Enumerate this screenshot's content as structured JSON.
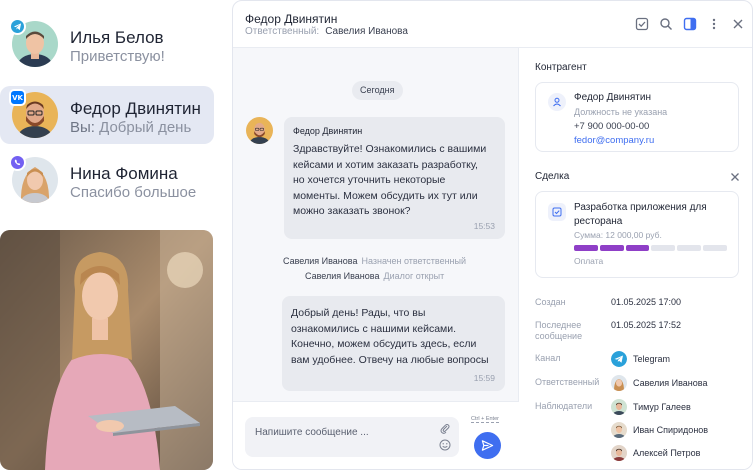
{
  "contacts": [
    {
      "name": "Илья Белов",
      "preview": "Приветствую!",
      "channel": "telegram-icon"
    },
    {
      "name": "Федор Двинятин",
      "preview_prefix": "Вы:",
      "preview": "Добрый день",
      "channel": "vk-icon",
      "channel_text": "VK"
    },
    {
      "name": "Нина Фомина",
      "preview": "Спасибо большое",
      "channel": "viber-icon"
    }
  ],
  "header": {
    "name": "Федор Двинятин",
    "responsible_label": "Ответственный:",
    "responsible_value": "Савелия Иванова"
  },
  "chat": {
    "date": "Сегодня",
    "incoming": {
      "author": "Федор Двинятин",
      "text": "Здравствуйте! Ознакомились с вашими\nкейсами и хотим заказать разработку,\nно хочется уточнить некоторые\nмоменты. Можем обсудить их тут или\nможно заказать звонок?",
      "time": "15:53"
    },
    "system": [
      {
        "actor": "Савелия Иванова",
        "event": "Назначен ответственный"
      },
      {
        "actor": "Савелия Иванова",
        "event": "Диалог открыт"
      }
    ],
    "outgoing": {
      "text": "Добрый день! Рады, что вы\nознакомились с нашими кейсами.\nКонечно, можем обсудить здесь, если\nвам удобнее. Отвечу на любые вопросы",
      "time": "15:59"
    }
  },
  "composer": {
    "placeholder": "Напишите сообщение ...",
    "hint": "Ctrl + Enter"
  },
  "info": {
    "contractor_title": "Контрагент",
    "contact": {
      "name": "Федор Двинятин",
      "position": "Должность не указана",
      "phone": "+7 900 000-00-00",
      "email": "fedor@company.ru"
    },
    "deal_title": "Сделка",
    "deal": {
      "name": "Разработка приложения для ресторана",
      "sum": "Сумма: 12 000,00 руб.",
      "stage": "Оплата",
      "stages_total": 6,
      "stages_done": 3
    },
    "meta": {
      "created_label": "Создан",
      "created_value": "01.05.2025 17:00",
      "last_msg_label": "Последнее сообщение",
      "last_msg_value": "01.05.2025 17:52",
      "channel_label": "Канал",
      "channel_value": "Telegram",
      "responsible_label": "Ответственный",
      "responsible_value": "Савелия Иванова",
      "observers_label": "Наблюдатели",
      "observers": [
        "Тимур Галеев",
        "Иван Спиридонов",
        "Алексей Петров"
      ]
    }
  },
  "colors": {
    "accent": "#3f6ef0",
    "selected_row": "#e4e8f3",
    "deal_progress": "#8f3fc7",
    "telegram": "#2aa1da",
    "vk": "#0077ff",
    "viber": "#7360f2"
  }
}
